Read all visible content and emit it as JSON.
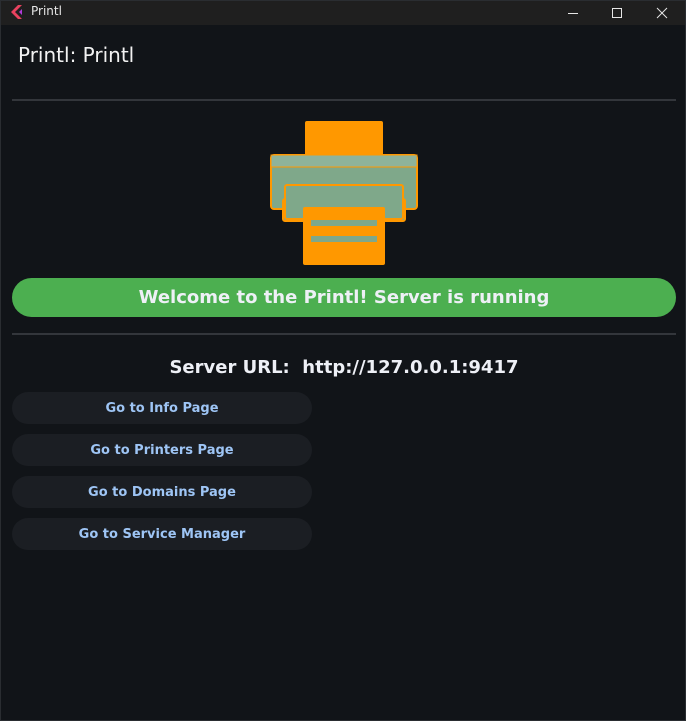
{
  "window": {
    "title": "Printl",
    "minimize_icon": "minimize-icon",
    "maximize_icon": "maximize-icon",
    "close_icon": "close-icon"
  },
  "page": {
    "title": "Printl: Printl",
    "hero_icon": "printer-icon"
  },
  "status": {
    "message": "Welcome to the Printl! Server is running",
    "color": "#4caf50"
  },
  "server": {
    "label": "Server URL:",
    "url": "http://127.0.0.1:9417"
  },
  "nav_buttons": [
    {
      "label": "Go to Info Page"
    },
    {
      "label": "Go to Printers Page"
    },
    {
      "label": "Go to Domains Page"
    },
    {
      "label": "Go to Service Manager"
    }
  ],
  "colors": {
    "accent": "#ff9800",
    "background": "#111418",
    "link": "#9ec5f5"
  }
}
